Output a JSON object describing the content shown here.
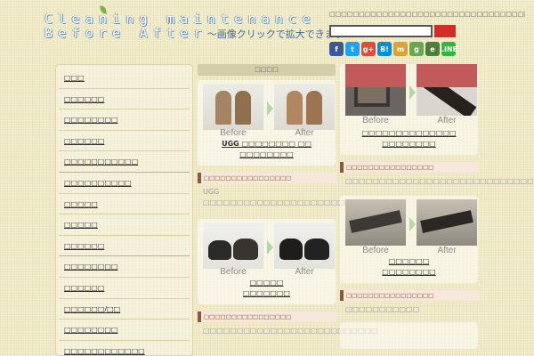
{
  "header": {
    "title_line1": "Cleaning maintenance",
    "title_line2": "Before After",
    "tagline": "〜画像クリックで拡大できます〜",
    "notice": "□□□□□□□□□□□□□□□□□□□□□□□□□□□□□□□□□□!",
    "search": {
      "value": "",
      "placeholder": ""
    },
    "social": [
      {
        "name": "facebook-icon",
        "glyph": "f",
        "color": "#3b5998"
      },
      {
        "name": "twitter-icon",
        "glyph": "t",
        "color": "#1da1f2"
      },
      {
        "name": "google-plus-icon",
        "glyph": "g+",
        "color": "#dd4b39"
      },
      {
        "name": "hatena-icon",
        "glyph": "B!",
        "color": "#008fde"
      },
      {
        "name": "mixi-icon",
        "glyph": "m",
        "color": "#d8a33b"
      },
      {
        "name": "google-icon",
        "glyph": "g",
        "color": "#6aa84f"
      },
      {
        "name": "evernote-icon",
        "glyph": "e",
        "color": "#4c7f3a"
      },
      {
        "name": "line-icon",
        "glyph": "LINE",
        "color": "#2fb93c"
      }
    ]
  },
  "sidebar": {
    "items": [
      {
        "label": "□□□"
      },
      {
        "label": "□□□□□□"
      },
      {
        "label": "□□□□□□□□"
      },
      {
        "label": "□□□□□□"
      },
      {
        "label": "□□□□□□□□□□□"
      },
      {
        "label": "□□□□□□□□□□"
      },
      {
        "label": "□□□□□"
      },
      {
        "label": "□□□□□"
      },
      {
        "label": "□□□□□□"
      },
      {
        "label": "□□□□□□□□"
      },
      {
        "label": "□□□□□□"
      },
      {
        "label": "□□□□□□/□□"
      },
      {
        "label": "□□□□□□□□"
      },
      {
        "label": "□□□□□□□□□□□□"
      }
    ]
  },
  "middle": {
    "section_title": "□□□□",
    "cards": [
      {
        "before": "Before",
        "after": "After",
        "title_line1": "UGG □□□□□□□□ □□",
        "title_line2": "□□□□□□□□",
        "bar": "□□□□□□□□□□□□□□□□",
        "desc": "UGG □□□□□□□□□□□□□□□□□□□□□□□□□□□□□□"
      },
      {
        "before": "Before",
        "after": "After",
        "title_line1": "□□□□□",
        "title_line2": "□□□□□□□",
        "bar": "□□□□□□□□□□□□□□□□",
        "desc": "□□□□□□□□□□□□□□□□□□□□□□□□□□"
      }
    ]
  },
  "right": {
    "cards": [
      {
        "before": "Before",
        "after": "After",
        "title_line1": "□□□□□□□□□□□□□□",
        "title_line2": "□□□□□□□□",
        "bar": "□□□□□□□□□□□□□□□□",
        "desc": "□□□□□□□□□□□□□□□□□□□□□□□□□□□□□"
      },
      {
        "before": "Before",
        "after": "After",
        "title_line1": "□□□□□□",
        "title_line2": "□□□□□□□□",
        "bar": "□□□□□□□□□□□□□□□□",
        "desc": "□□□□□□□□□□□"
      }
    ]
  }
}
